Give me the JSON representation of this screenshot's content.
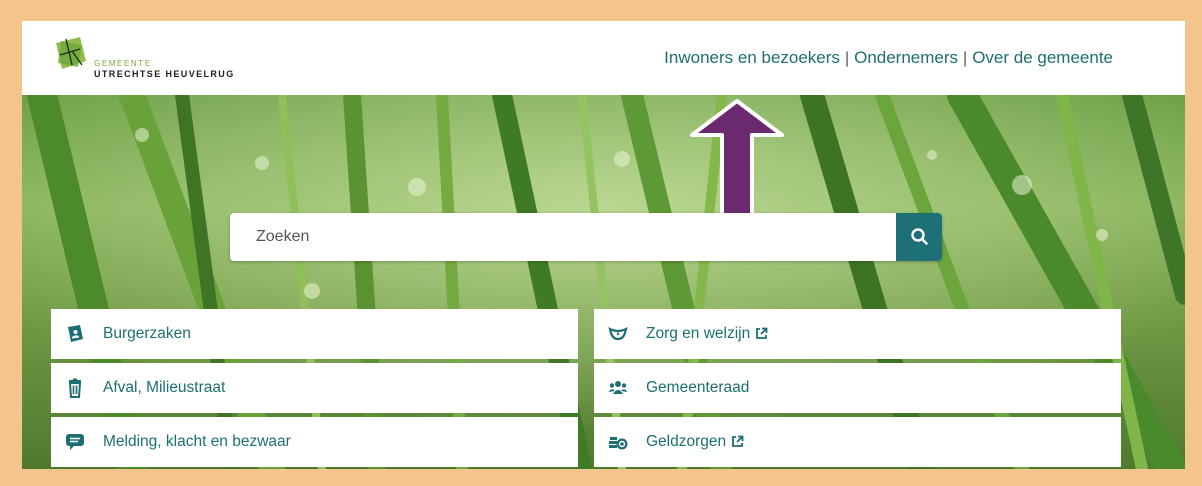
{
  "header": {
    "logo_small": "GEMEENTE",
    "logo_big": "UTRECHTSE HEUVELRUG",
    "nav": [
      {
        "label": "Inwoners en bezoekers"
      },
      {
        "label": "Ondernemers"
      },
      {
        "label": "Over de gemeente"
      }
    ]
  },
  "search": {
    "placeholder": "Zoeken",
    "icon": "search-icon"
  },
  "annotation": {
    "arrow_color": "#6b2a6f"
  },
  "tiles": [
    {
      "label": "Burgerzaken",
      "icon": "id-card-icon"
    },
    {
      "label": "Zorg en welzijn",
      "icon": "heart-hands-icon",
      "external": true
    },
    {
      "label": "Afval, Milieustraat",
      "icon": "trash-icon"
    },
    {
      "label": "Gemeenteraad",
      "icon": "people-icon"
    },
    {
      "label": "Melding, klacht en bezwaar",
      "icon": "speech-bubble-icon"
    },
    {
      "label": "Geldzorgen",
      "icon": "coins-icon",
      "external": true
    }
  ],
  "colors": {
    "brand": "#1d6f73",
    "border": "#f3c58c",
    "logo_green": "#7ea83f"
  }
}
